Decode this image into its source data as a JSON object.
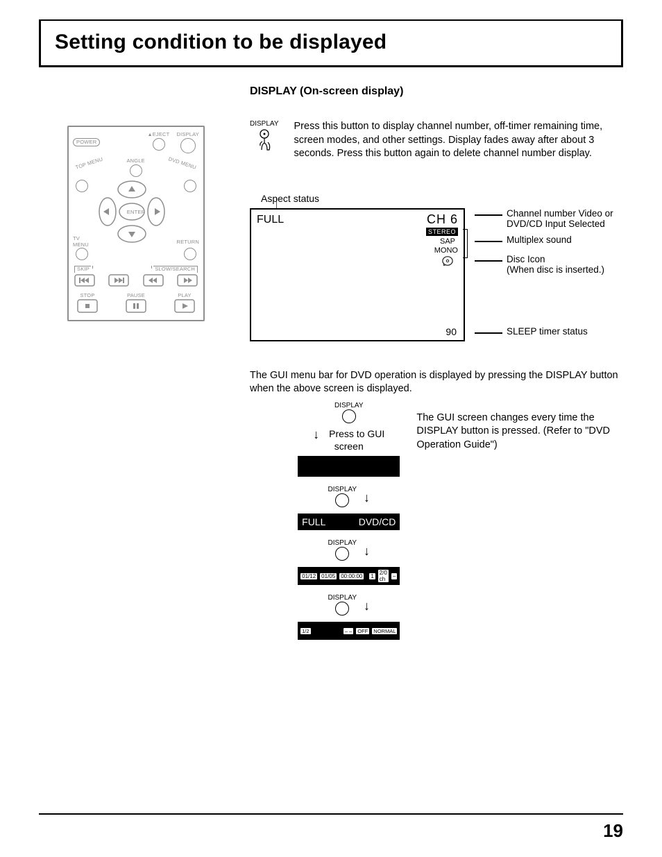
{
  "page_title": "Setting condition to be displayed",
  "section_heading": "DISPLAY (On-screen display)",
  "remote": {
    "power": "POWER",
    "eject": "EJECT",
    "display": "DISPLAY",
    "top_menu": "TOP MENU",
    "angle": "ANGLE",
    "dvd_menu": "DVD MENU",
    "enter": "ENTER",
    "tv_menu_top": "TV",
    "tv_menu_bottom": "MENU",
    "return": "RETURN",
    "skip": "SKIP",
    "slow_search": "SLOW/SEARCH",
    "stop": "STOP",
    "pause": "PAUSE",
    "play": "PLAY"
  },
  "display_icon_label": "DISPLAY",
  "intro_paragraph": "Press this button to display channel number, off-timer remaining time, screen modes, and other settings. Display fades away after about 3 seconds. Press this button again to delete channel number display.",
  "aspect_status_label": "Aspect status",
  "osd": {
    "full": "FULL",
    "channel": "CH  6",
    "stereo": "STEREO",
    "sap": "SAP",
    "mono": "MONO",
    "sleep_value": "90"
  },
  "callouts": {
    "channel": "Channel number Video or DVD/CD Input Selected",
    "multiplex": "Multiplex sound",
    "disc_title": "Disc Icon",
    "disc_sub": "(When disc is inserted.)",
    "sleep": "SLEEP timer status"
  },
  "mid_paragraph": "The GUI menu bar for DVD operation is displayed by pressing the DISPLAY button when the above screen is displayed.",
  "gui_flow": {
    "display_label": "DISPLAY",
    "press_to_gui": "Press to GUI screen",
    "bar_full": "FULL",
    "bar_dvdcd": "DVD/CD",
    "info_a": "01/12",
    "info_b": "01/05",
    "info_c": "00:00:00",
    "info_d": "1",
    "info_e": "2/0 ch",
    "bottom_a": "1/2",
    "bottom_b": "OFF",
    "bottom_c": "NORMAL"
  },
  "gui_side_text": "The GUI screen changes every time the DISPLAY button is pressed. (Refer to \"DVD Operation Guide\")",
  "page_number": "19"
}
